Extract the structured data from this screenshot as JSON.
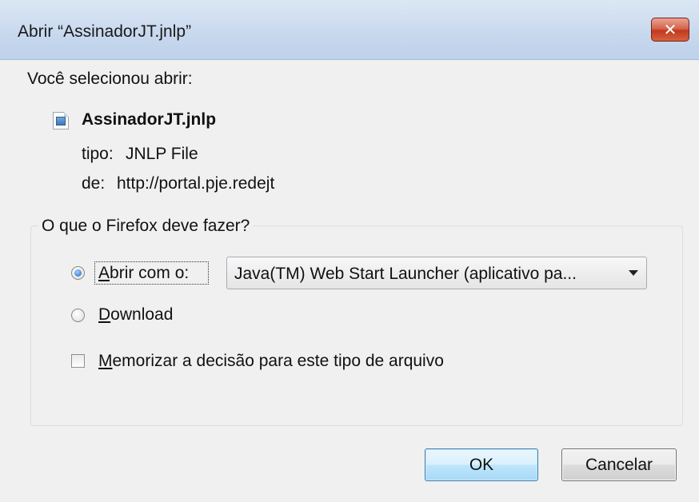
{
  "dialog": {
    "title": "Abrir “AssinadorJT.jnlp”",
    "close_symbol": "✕"
  },
  "info": {
    "intro": "Você selecionou abrir:",
    "file_name": "AssinadorJT.jnlp",
    "file_icon": "jnlp-file-icon",
    "type_label": "tipo:",
    "type_value": "JNLP File",
    "from_label": "de:",
    "from_value": "http://portal.pje.redejt"
  },
  "action_group": {
    "legend": "O que o Firefox deve fazer?",
    "open_with": {
      "prefix": "A",
      "rest": "brir com o:",
      "checked": true
    },
    "application_select": {
      "value": "Java(TM) Web Start Launcher (aplicativo pa..."
    },
    "download": {
      "prefix": "D",
      "rest": "ownload",
      "checked": false
    },
    "remember": {
      "prefix": "M",
      "rest": "emorizar a decisão para este tipo de arquivo",
      "checked": false
    }
  },
  "buttons": {
    "ok": "OK",
    "cancel": "Cancelar"
  }
}
